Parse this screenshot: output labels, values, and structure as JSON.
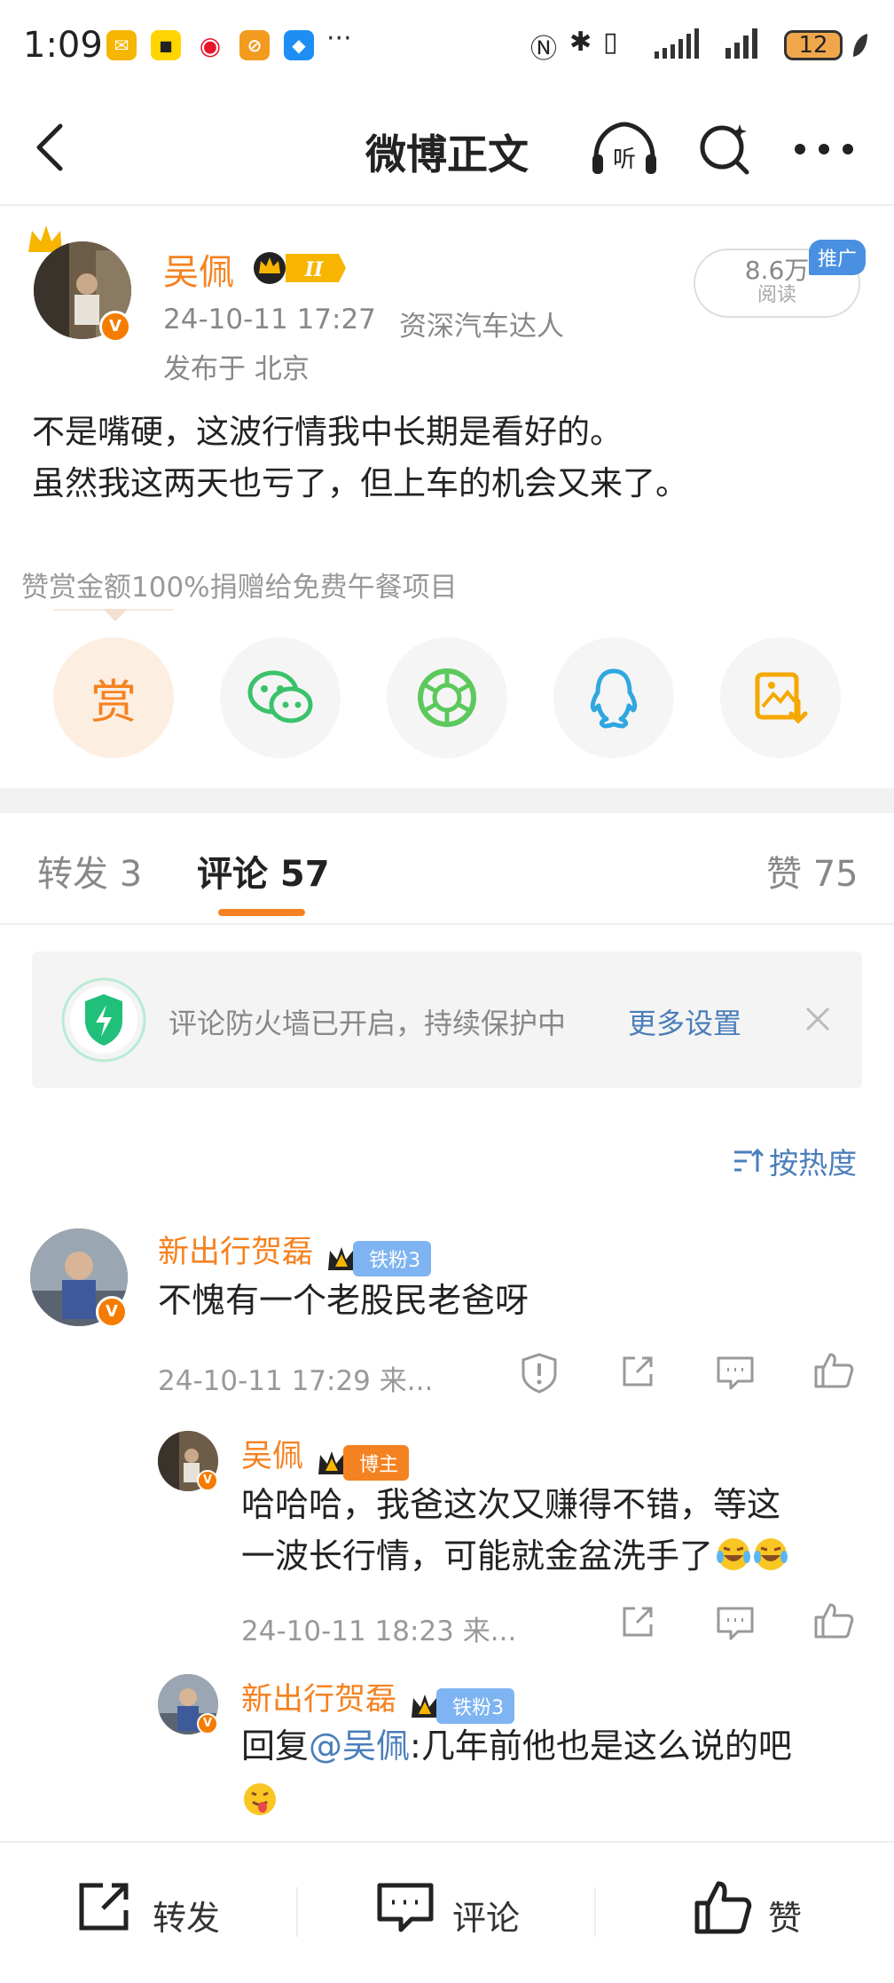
{
  "status_bar": {
    "time": "1:09",
    "more_dots": "···",
    "battery": "12"
  },
  "nav": {
    "title": "微博正文"
  },
  "post": {
    "author": "吴佩",
    "timestamp": "24-10-11 17:27",
    "author_tag": "资深汽车达人",
    "location": "发布于 北京",
    "read_count": "8.6万",
    "read_label": "阅读",
    "promo_badge": "推广",
    "lines": [
      "不是嘴硬，这波行情我中长期是看好的。",
      "虽然我这两天也亏了，但上车的机会又来了。"
    ],
    "reward_note": "赞赏金额100%捐赠给免费午餐项目",
    "reward_label": "赏"
  },
  "tabs": {
    "repost": "转发 3",
    "comment": "评论 57",
    "like": "赞 75"
  },
  "firewall": {
    "text": "评论防火墙已开启，持续保护中",
    "link": "更多设置"
  },
  "sort_label": "按热度",
  "comments": [
    {
      "name": "新出行贺磊",
      "badge": "铁粉3",
      "text": "不愧有一个老股民老爸呀",
      "meta": "24-10-11 17:29 来..."
    },
    {
      "name": "吴佩",
      "badge": "博主",
      "text1": "哈哈哈，我爸这次又赚得不错，等这",
      "text2": "一波长行情，可能就金盆洗手了",
      "meta": "24-10-11 18:23 来..."
    },
    {
      "name": "新出行贺磊",
      "badge": "铁粉3",
      "reply_prefix": "回复",
      "mention": "@吴佩",
      "reply_text": ":几年前他也是这么说的吧"
    }
  ],
  "bottom_bar": {
    "repost": "转发",
    "comment": "评论",
    "like": "赞"
  },
  "colors": {
    "accent": "#f58220",
    "link": "#4a7ebb",
    "fan_badge": "#7eb4f2",
    "shield": "#21c07a"
  }
}
